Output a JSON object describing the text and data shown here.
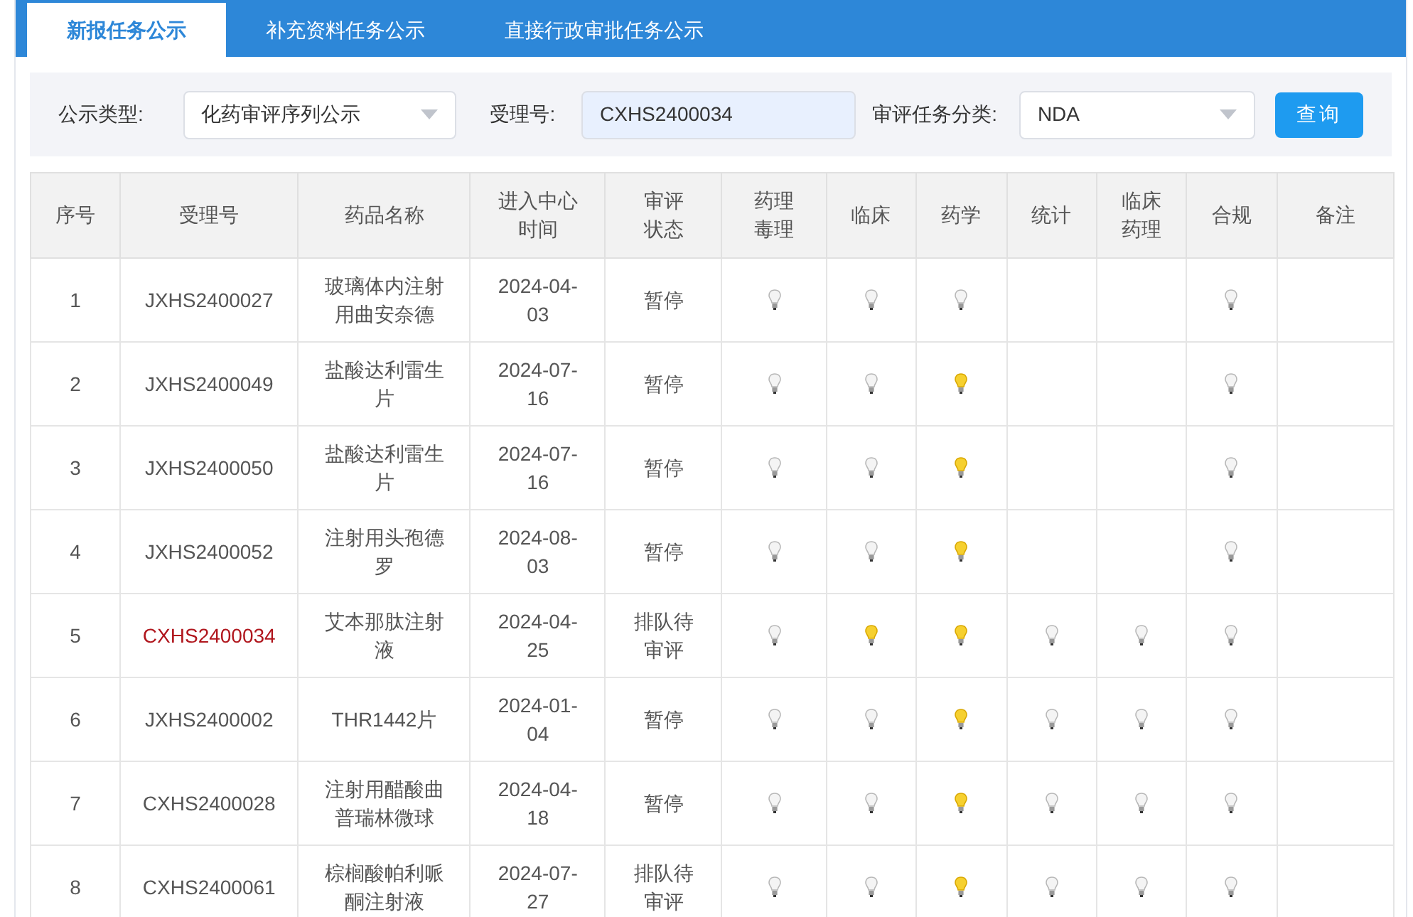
{
  "tabs": [
    {
      "label": "新报任务公示",
      "selected": true
    },
    {
      "label": "补充资料任务公示",
      "selected": false
    },
    {
      "label": "直接行政审批任务公示",
      "selected": false
    }
  ],
  "filters": {
    "type_label": "公示类型:",
    "type_value": "化药审评序列公示",
    "accept_label": "受理号:",
    "accept_value": "CXHS2400034",
    "category_label": "审评任务分类:",
    "category_value": "NDA",
    "query_button": "查询"
  },
  "table": {
    "columns": [
      "序号",
      "受理号",
      "药品名称",
      "进入中心时间",
      "审评状态",
      "药理毒理",
      "临床",
      "药学",
      "统计",
      "临床药理",
      "合规",
      "备注"
    ],
    "rows": [
      {
        "no": "1",
        "accept_no": "JXHS2400027",
        "highlighted": false,
        "drug": "玻璃体内注射用曲安奈德",
        "date": "2024-04-03",
        "status": "暂停",
        "bulbs": [
          {
            "kind": "unlit"
          },
          {
            "kind": "unlit"
          },
          {
            "kind": "unlit"
          },
          {
            "kind": "empty"
          },
          {
            "kind": "empty"
          },
          {
            "kind": "unlit"
          }
        ]
      },
      {
        "no": "2",
        "accept_no": "JXHS2400049",
        "highlighted": false,
        "drug": "盐酸达利雷生片",
        "date": "2024-07-16",
        "status": "暂停",
        "bulbs": [
          {
            "kind": "unlit"
          },
          {
            "kind": "unlit"
          },
          {
            "kind": "lit"
          },
          {
            "kind": "empty"
          },
          {
            "kind": "empty"
          },
          {
            "kind": "unlit"
          }
        ]
      },
      {
        "no": "3",
        "accept_no": "JXHS2400050",
        "highlighted": false,
        "drug": "盐酸达利雷生片",
        "date": "2024-07-16",
        "status": "暂停",
        "bulbs": [
          {
            "kind": "unlit"
          },
          {
            "kind": "unlit"
          },
          {
            "kind": "lit"
          },
          {
            "kind": "empty"
          },
          {
            "kind": "empty"
          },
          {
            "kind": "unlit"
          }
        ]
      },
      {
        "no": "4",
        "accept_no": "JXHS2400052",
        "highlighted": false,
        "drug": "注射用头孢德罗",
        "date": "2024-08-03",
        "status": "暂停",
        "bulbs": [
          {
            "kind": "unlit"
          },
          {
            "kind": "unlit"
          },
          {
            "kind": "lit"
          },
          {
            "kind": "empty"
          },
          {
            "kind": "empty"
          },
          {
            "kind": "unlit"
          }
        ]
      },
      {
        "no": "5",
        "accept_no": "CXHS2400034",
        "highlighted": true,
        "drug": "艾本那肽注射液",
        "date": "2024-04-25",
        "status": "排队待审评",
        "bulbs": [
          {
            "kind": "unlit"
          },
          {
            "kind": "lit"
          },
          {
            "kind": "lit"
          },
          {
            "kind": "unlit"
          },
          {
            "kind": "unlit"
          },
          {
            "kind": "unlit"
          }
        ]
      },
      {
        "no": "6",
        "accept_no": "JXHS2400002",
        "highlighted": false,
        "drug": "THR1442片",
        "date": "2024-01-04",
        "status": "暂停",
        "bulbs": [
          {
            "kind": "unlit"
          },
          {
            "kind": "unlit"
          },
          {
            "kind": "lit"
          },
          {
            "kind": "unlit"
          },
          {
            "kind": "unlit"
          },
          {
            "kind": "unlit"
          }
        ]
      },
      {
        "no": "7",
        "accept_no": "CXHS2400028",
        "highlighted": false,
        "drug": "注射用醋酸曲普瑞林微球",
        "date": "2024-04-18",
        "status": "暂停",
        "bulbs": [
          {
            "kind": "unlit"
          },
          {
            "kind": "unlit"
          },
          {
            "kind": "lit"
          },
          {
            "kind": "unlit"
          },
          {
            "kind": "unlit"
          },
          {
            "kind": "unlit"
          }
        ]
      },
      {
        "no": "8",
        "accept_no": "CXHS2400061",
        "highlighted": false,
        "drug": "棕榈酸帕利哌酮注射液",
        "date": "2024-07-27",
        "status": "排队待审评",
        "bulbs": [
          {
            "kind": "unlit"
          },
          {
            "kind": "unlit"
          },
          {
            "kind": "lit"
          },
          {
            "kind": "unlit"
          },
          {
            "kind": "unlit"
          },
          {
            "kind": "unlit"
          }
        ]
      }
    ]
  }
}
